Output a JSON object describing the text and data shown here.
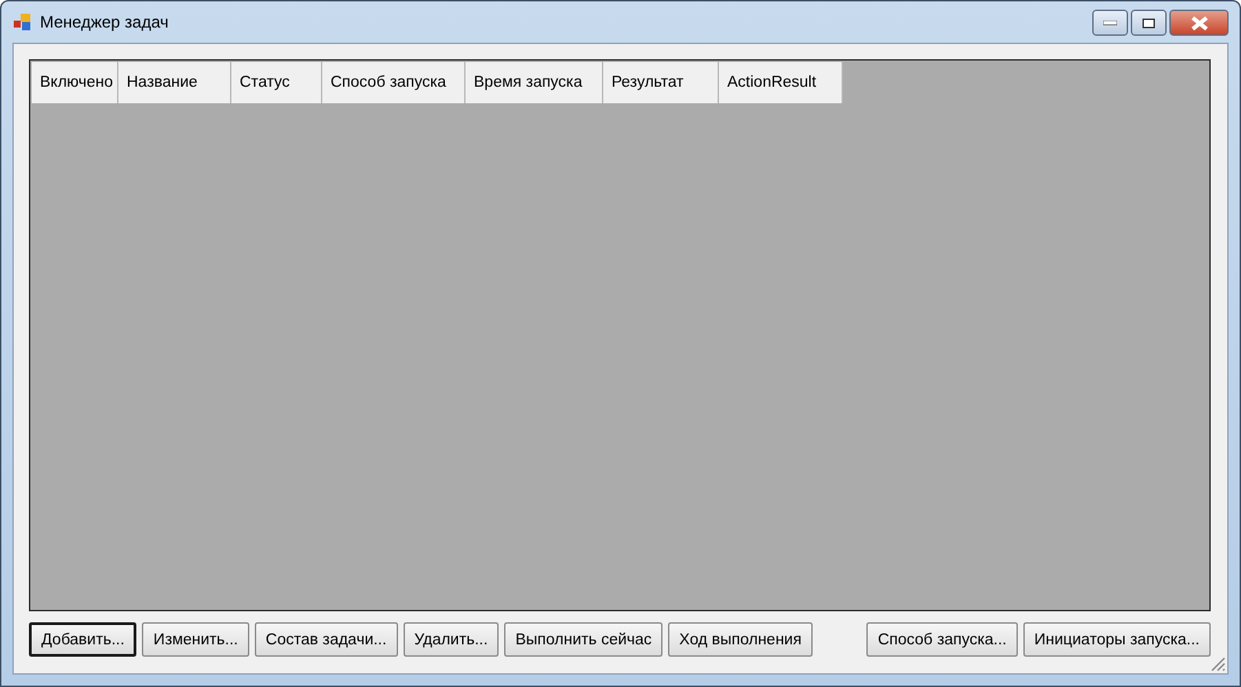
{
  "window": {
    "title": "Менеджер задач"
  },
  "table": {
    "columns": [
      "Включено",
      "Название",
      "Статус",
      "Способ запуска",
      "Время запуска",
      "Результат",
      "ActionResult"
    ]
  },
  "buttons_left": [
    {
      "label": "Добавить...",
      "default": true
    },
    {
      "label": "Изменить...",
      "default": false
    },
    {
      "label": "Состав задачи...",
      "default": false
    },
    {
      "label": "Удалить...",
      "default": false
    },
    {
      "label": "Выполнить сейчас",
      "default": false
    },
    {
      "label": "Ход выполнения",
      "default": false
    }
  ],
  "buttons_right": [
    {
      "label": "Способ запуска...",
      "default": false
    },
    {
      "label": "Инициаторы запуска...",
      "default": false
    }
  ]
}
